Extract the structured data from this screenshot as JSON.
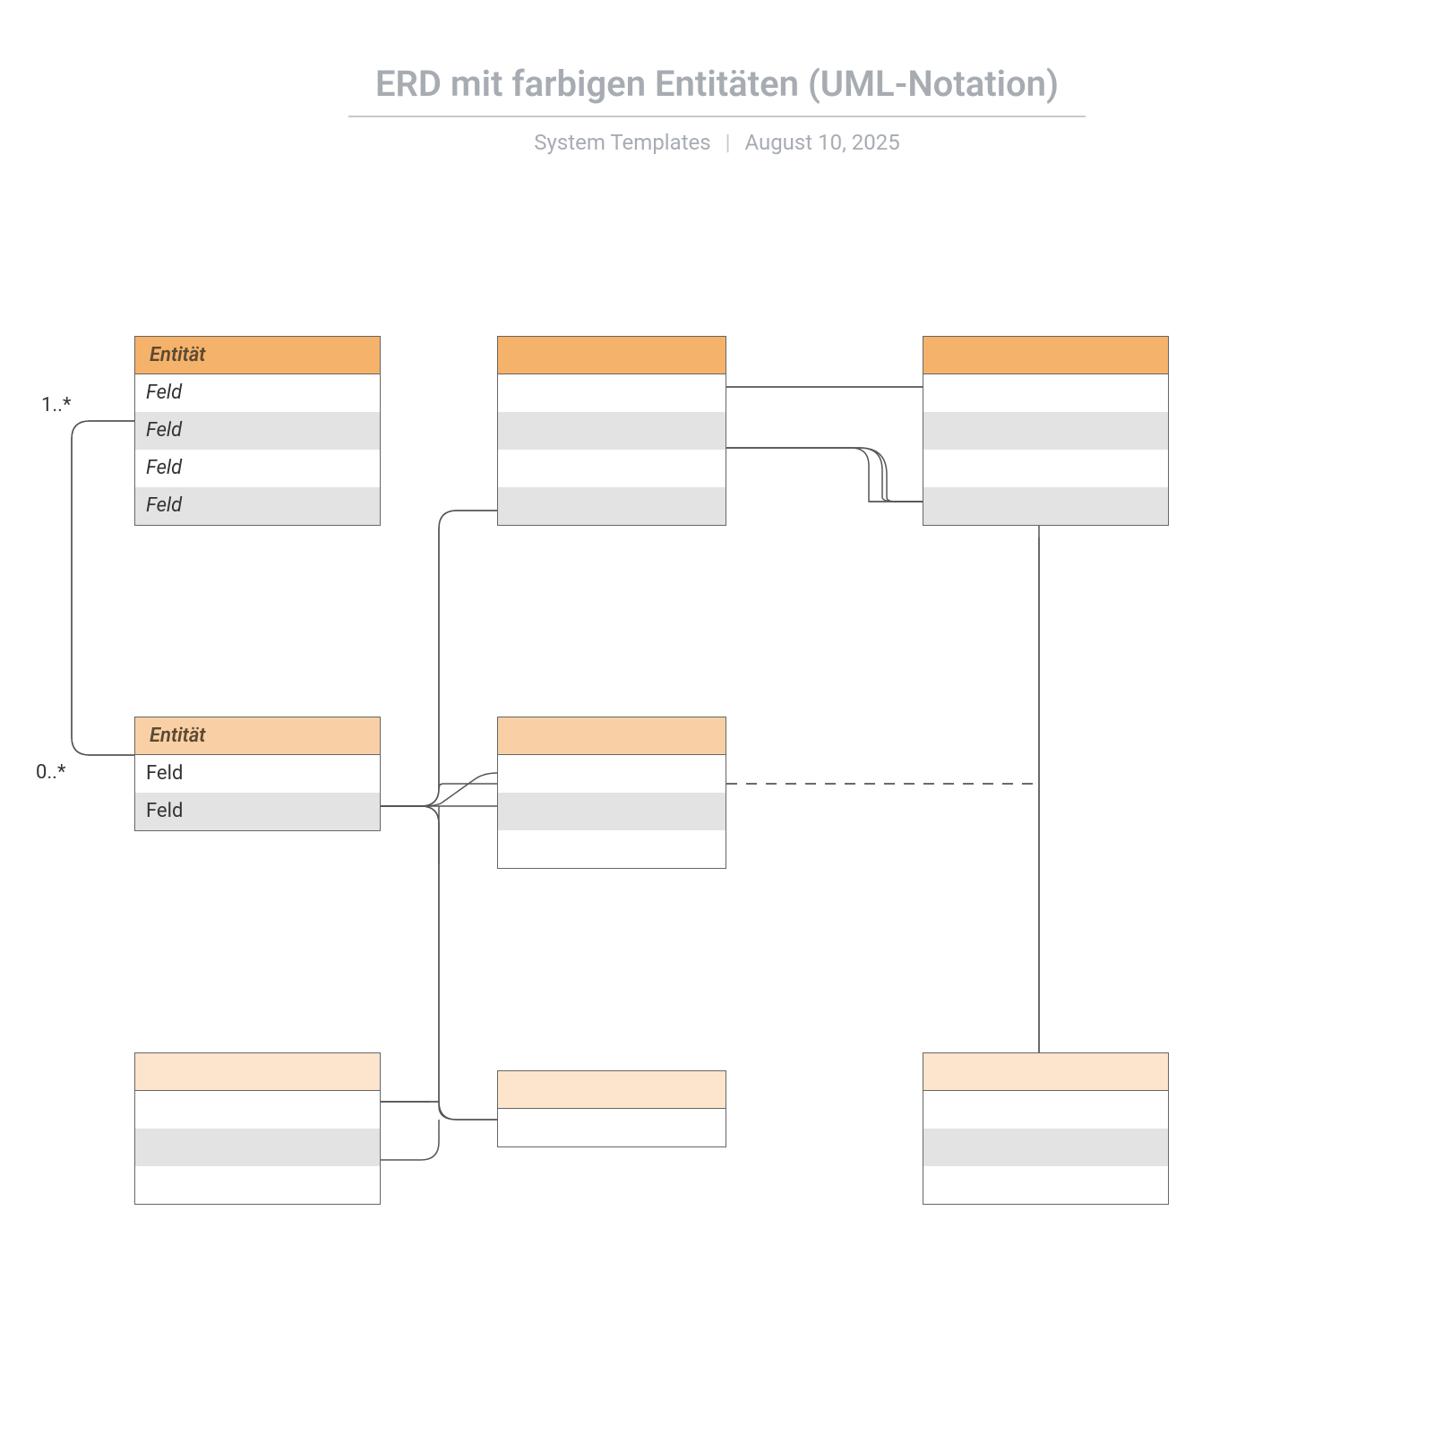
{
  "header": {
    "title": "ERD mit farbigen Entitäten (UML-Notation)",
    "subtitle_left": "System Templates",
    "subtitle_right": "August 10, 2025"
  },
  "colors": {
    "orange_strong": "#f5b26b",
    "orange_mid": "#f9d0a5",
    "orange_light": "#fde4cc"
  },
  "labels": {
    "card_top": "1..*",
    "card_bottom": "0..*"
  },
  "entities": {
    "e1": {
      "name": "Entität",
      "fields": [
        "Feld",
        "Feld",
        "Feld",
        "Feld"
      ],
      "italic_fields": true
    },
    "e2": {
      "name": "Entität",
      "fields": [
        "Feld",
        "Feld"
      ],
      "italic_fields": false
    }
  }
}
